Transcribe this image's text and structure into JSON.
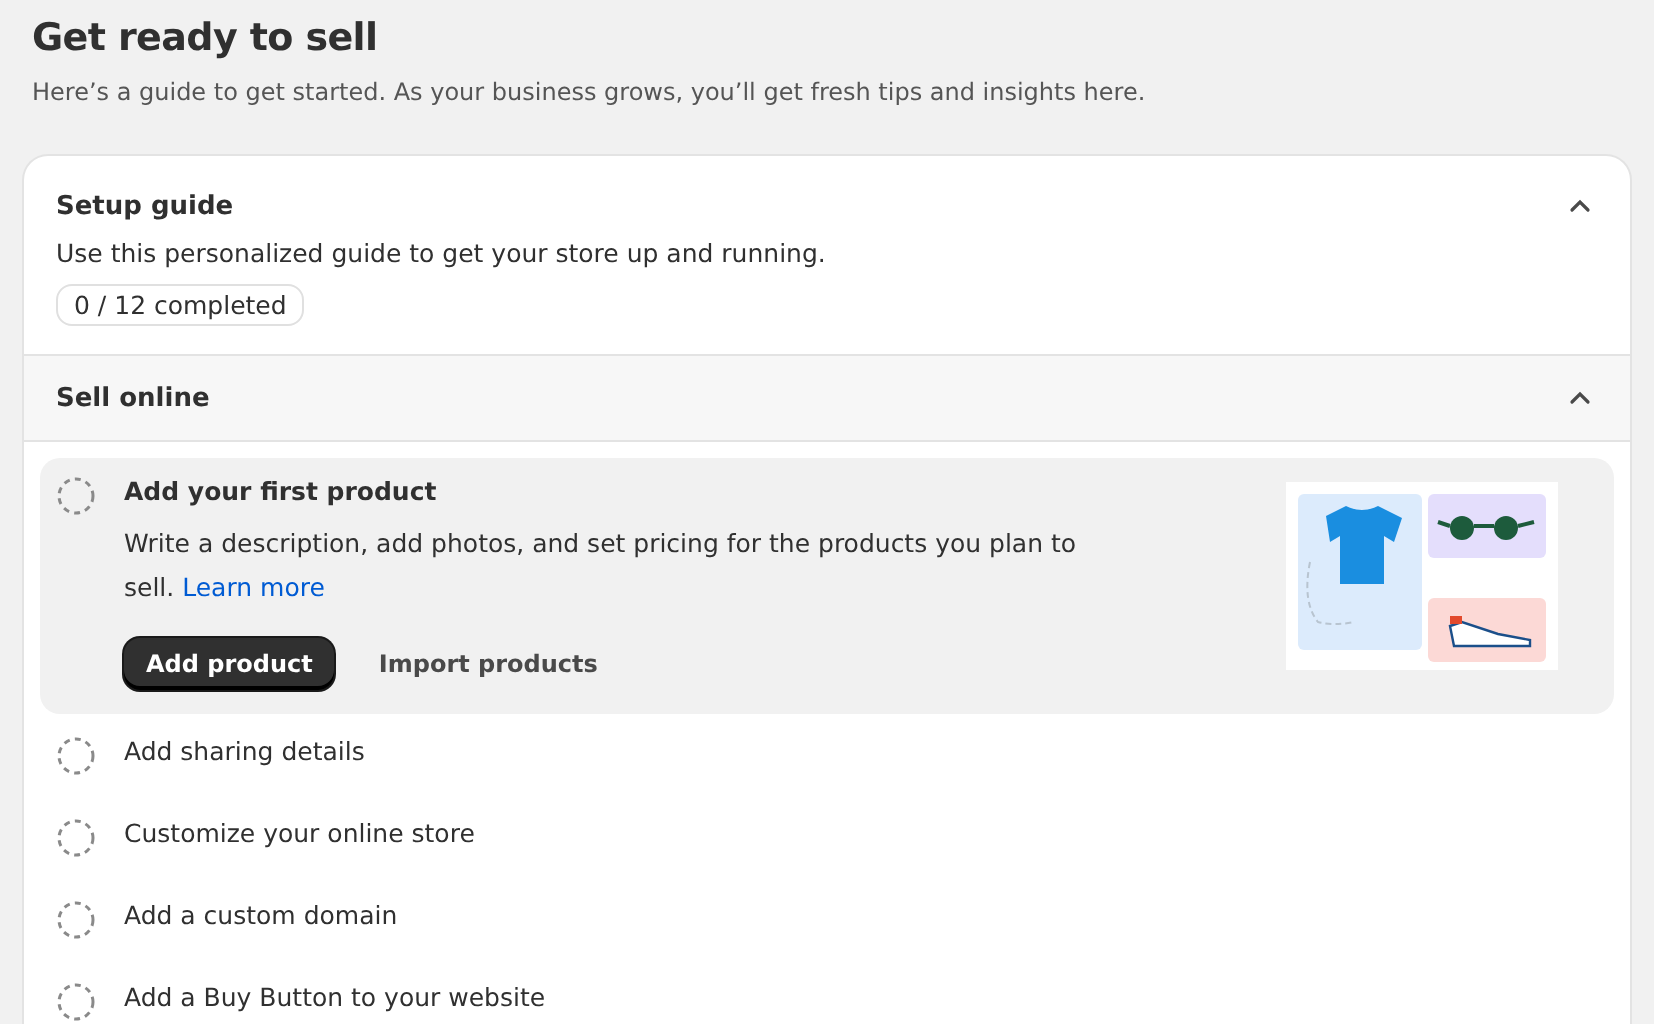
{
  "page": {
    "title": "Get ready to sell",
    "subtitle": "Here’s a guide to get started. As your business grows, you’ll get fresh tips and insights here."
  },
  "setup_guide": {
    "title": "Setup guide",
    "expanded": true,
    "description": "Use this personalized guide to get your store up and running.",
    "progress": "0 / 12 completed"
  },
  "section": {
    "title": "Sell online",
    "expanded": true
  },
  "tasks": [
    {
      "title": "Add your first product",
      "completed": false,
      "expanded": true,
      "description": "Write a description, add photos, and set pricing for the products you plan to sell.",
      "link": "Learn more",
      "primary_button": "Add product",
      "secondary_button": "Import products"
    },
    {
      "title": "Add sharing details",
      "completed": false,
      "expanded": false
    },
    {
      "title": "Customize your online store",
      "completed": false,
      "expanded": false
    },
    {
      "title": "Add a custom domain",
      "completed": false,
      "expanded": false
    },
    {
      "title": "Add a Buy Button to your website",
      "completed": false,
      "expanded": false
    }
  ]
}
